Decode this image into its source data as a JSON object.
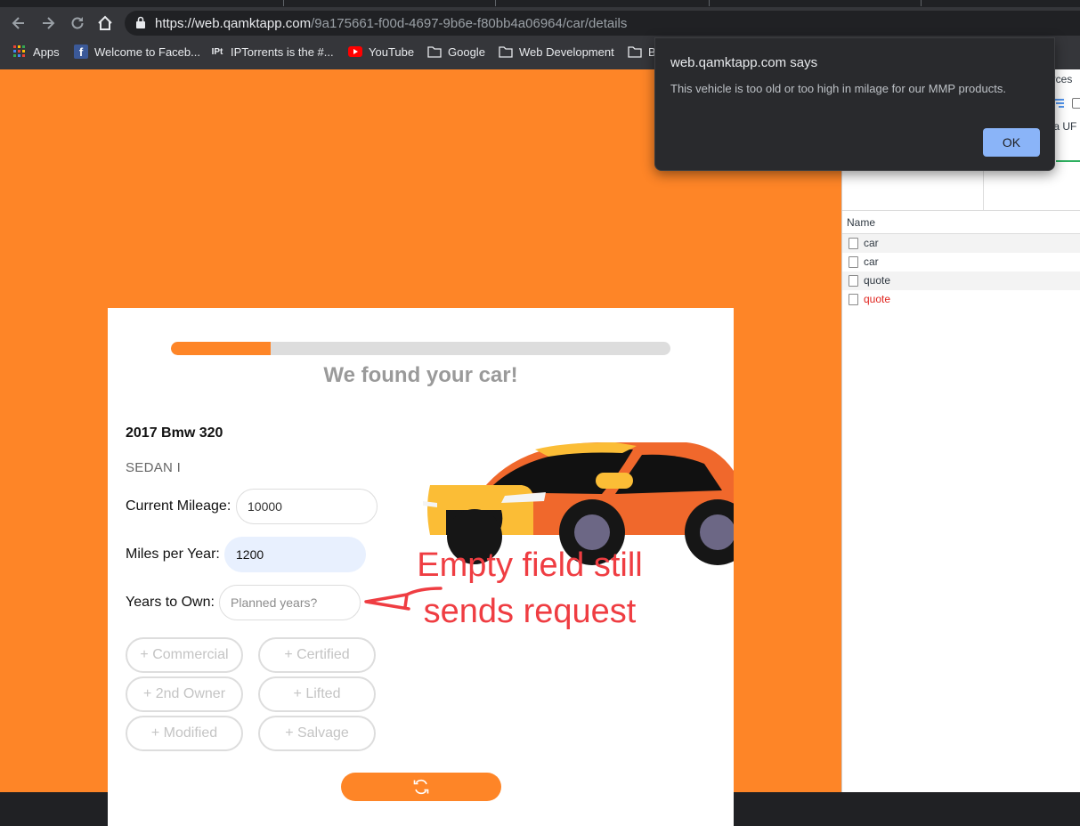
{
  "browser": {
    "url_host": "https://web.qamktapp.com",
    "url_path": "/9a175661-f00d-4697-9b6e-f80bb4a06964/car/details",
    "bookmarks": [
      {
        "label": "Apps",
        "icon": "apps-grid-icon"
      },
      {
        "label": "Welcome to Faceb...",
        "icon": "facebook-icon"
      },
      {
        "label": "IPTorrents is the #...",
        "icon": "iptorrents-icon"
      },
      {
        "label": "YouTube",
        "icon": "youtube-icon"
      },
      {
        "label": "Google",
        "icon": "folder-icon"
      },
      {
        "label": "Web Development",
        "icon": "folder-icon"
      },
      {
        "label": "B",
        "icon": "folder-icon"
      }
    ]
  },
  "dialog": {
    "title": "web.qamktapp.com says",
    "message": "This vehicle is too old or too high in milage for our MMP products.",
    "ok_label": "OK"
  },
  "devtools": {
    "frag_sources": "urces",
    "frag_ta": "ta UF",
    "column_name": "Name",
    "requests": [
      {
        "name": "car",
        "status": "ok"
      },
      {
        "name": "car",
        "status": "ok"
      },
      {
        "name": "quote",
        "status": "ok"
      },
      {
        "name": "quote",
        "status": "error"
      }
    ]
  },
  "form": {
    "progress_fraction": 0.2,
    "heading": "We found your car!",
    "car_title": "2017 Bmw 320",
    "car_trim": "SEDAN I",
    "mileage_label": "Current Mileage:",
    "mileage_value": "10000",
    "miles_per_year_label": "Miles per Year:",
    "miles_per_year_value": "1200",
    "years_label": "Years to Own:",
    "years_placeholder": "Planned years?",
    "options": [
      "+ Commercial",
      "+ Certified",
      "+ 2nd Owner",
      "+ Lifted",
      "+ Modified",
      "+ Salvage"
    ],
    "submit_icon": "refresh-icon"
  },
  "annotation": {
    "line1": "Empty field still",
    "line2": "sends request"
  },
  "colors": {
    "brand_orange": "#fe8527",
    "annotation_red": "#ef3d42",
    "dialog_button": "#8ab4f8",
    "error_red": "#e0251f"
  }
}
